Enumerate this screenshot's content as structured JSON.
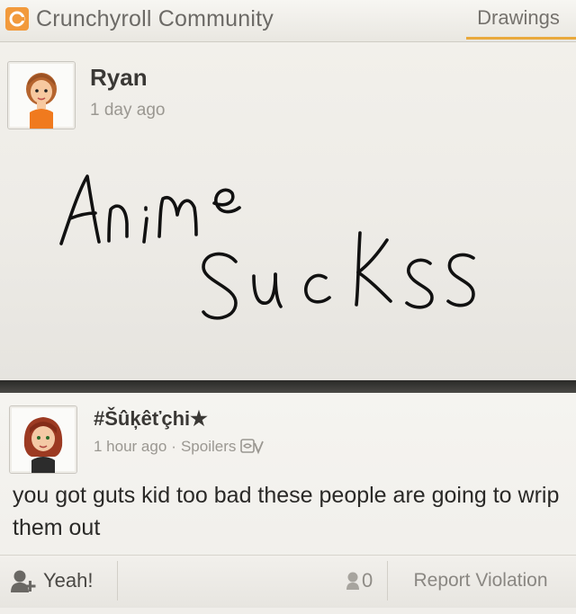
{
  "app": {
    "title": "Crunchyroll Community",
    "tab": "Drawings"
  },
  "post": {
    "user": "Ryan",
    "time": "1 day ago",
    "drawing_text": [
      "Anime",
      "Sucks"
    ]
  },
  "comment": {
    "user": "#Šûķêťçhi★",
    "time": "1 hour ago",
    "separator": "·",
    "spoilers_label": "Spoilers",
    "text": "you got guts kid too bad these people are going to wrip them out",
    "yeah_label": "Yeah!",
    "yeah_count": "0",
    "report_label": "Report Violation"
  },
  "colors": {
    "accent": "#e9a93c",
    "logo": "#f29a3c",
    "ink": "#111111"
  },
  "icons": {
    "logo": "crunchyroll-logo-icon",
    "spoiler": "spoiler-eye-icon",
    "yeah": "yeah-mii-icon",
    "yeah_count": "yeah-count-icon"
  }
}
